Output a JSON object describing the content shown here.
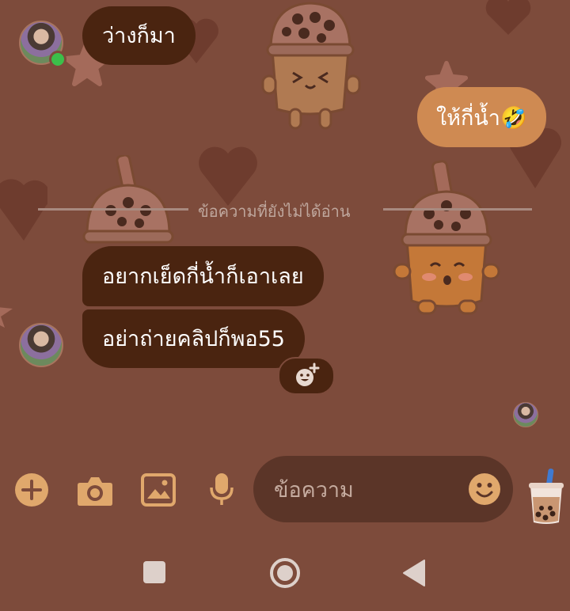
{
  "chat": {
    "messages": [
      {
        "text": "ว่างก็มา",
        "direction": "incoming"
      },
      {
        "text": "ให้กี่น้ำ🤣",
        "direction": "outgoing"
      },
      {
        "text": "อยากเย็ดกี่น้ำก็เอาเลย",
        "direction": "incoming"
      },
      {
        "text": "อย่าถ่ายคลิปก็พอ55",
        "direction": "incoming"
      }
    ],
    "unread_divider": "ข้อความที่ยังไม่ได้อ่าน"
  },
  "composer": {
    "placeholder": "ข้อความ",
    "buttons": [
      "add-icon",
      "camera-icon",
      "gallery-icon",
      "microphone-icon",
      "emoji-icon",
      "bubble-tea-sticker-icon"
    ]
  },
  "nav": [
    "recent-apps-icon",
    "home-icon",
    "back-icon"
  ],
  "colors": {
    "background": "#7d4b3b",
    "incoming_bubble": "#4a2410",
    "outgoing_bubble": "#cf8a52",
    "accent": "#e0a86c",
    "online": "#3cbf4a"
  }
}
